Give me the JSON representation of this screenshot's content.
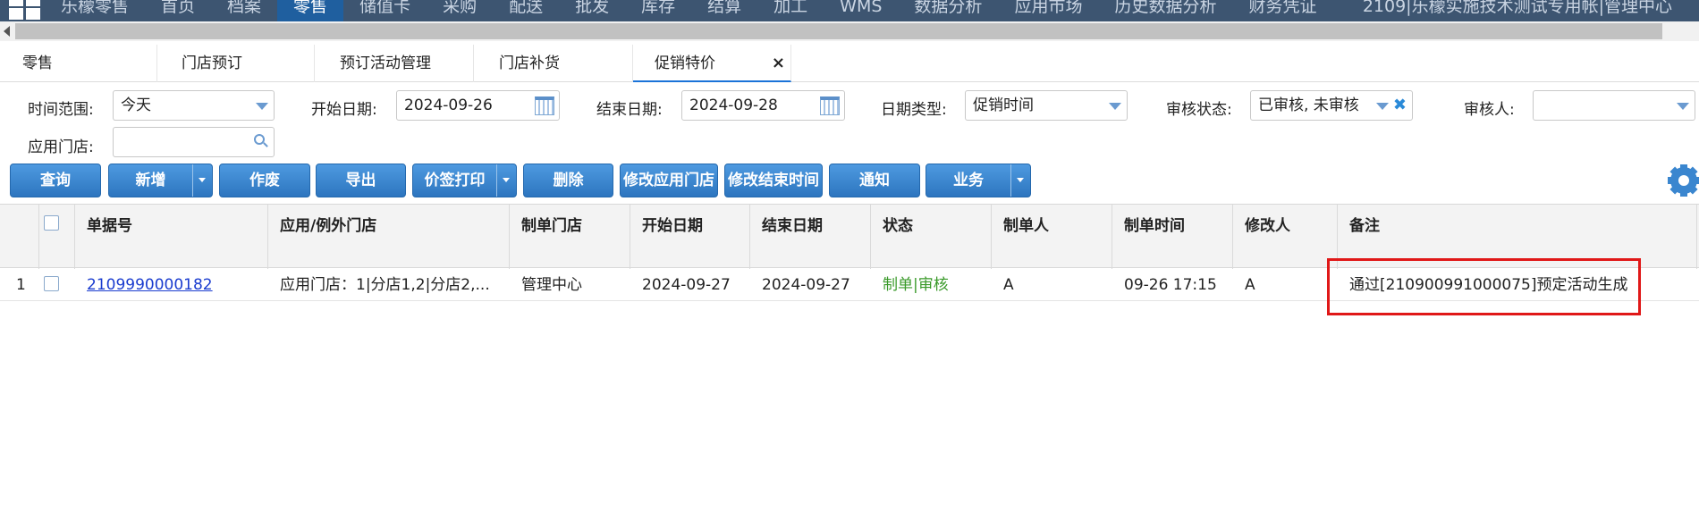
{
  "topnav": {
    "items": [
      "乐檬零售",
      "首页",
      "档案",
      "零售",
      "储值卡",
      "采购",
      "配送",
      "批发",
      "库存",
      "结算",
      "加工",
      "WMS",
      "数据分析",
      "应用市场",
      "历史数据分析",
      "财务凭证"
    ],
    "active_index": 3,
    "account": "2109|乐檬实施技术测试专用帐",
    "center": "|管理中心"
  },
  "tabs": [
    "零售",
    "门店预订",
    "预订活动管理",
    "门店补货",
    "促销特价"
  ],
  "active_tab_close": "×",
  "filters": {
    "time_range_label": "时间范围:",
    "time_range_value": "今天",
    "start_date_label": "开始日期:",
    "start_date_value": "2024-09-26",
    "end_date_label": "结束日期:",
    "end_date_value": "2024-09-28",
    "date_type_label": "日期类型:",
    "date_type_value": "促销时间",
    "audit_status_label": "审核状态:",
    "audit_status_value": "已审核, 未审核",
    "auditor_label": "审核人:",
    "auditor_value": "",
    "store_label": "应用门店:",
    "store_value": ""
  },
  "toolbar": {
    "query": "查询",
    "add": "新增",
    "void": "作废",
    "export": "导出",
    "price_print": "价签打印",
    "delete": "删除",
    "modify_store": "修改应用门店",
    "modify_end_time": "修改结束时间",
    "notify": "通知",
    "business": "业务"
  },
  "table": {
    "headers": [
      "单据号",
      "应用/例外门店",
      "制单门店",
      "开始日期",
      "结束日期",
      "状态",
      "制单人",
      "制单时间",
      "修改人",
      "备注"
    ],
    "rows": [
      {
        "index": "1",
        "doc_no": "2109990000182",
        "stores": "应用门店：1|分店1,2|分店2,...",
        "maker_store": "管理中心",
        "start_date": "2024-09-27",
        "end_date": "2024-09-27",
        "status": "制单|审核",
        "maker": "A",
        "make_time": "09-26 17:15",
        "modifier": "A",
        "remark": "通过[210900991000075]预定活动生成"
      }
    ]
  },
  "colors": {
    "nav_bg": "#3d5571",
    "nav_active": "#1f5f9f",
    "button": "#2d75bf",
    "link": "#1a3ccf",
    "status": "#3a9a2a",
    "highlight": "#e01818"
  }
}
